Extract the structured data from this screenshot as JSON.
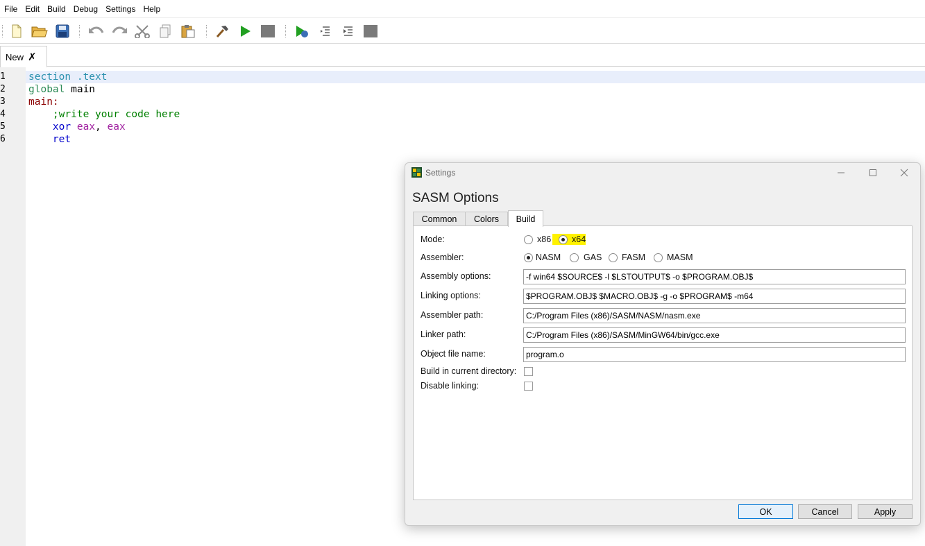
{
  "menubar": {
    "items": [
      "File",
      "Edit",
      "Build",
      "Debug",
      "Settings",
      "Help"
    ]
  },
  "toolbar": {
    "icons": [
      "new-file-icon",
      "open-folder-icon",
      "save-icon",
      "undo-icon",
      "redo-icon",
      "cut-icon",
      "copy-icon",
      "paste-icon",
      "build-hammer-icon",
      "run-icon",
      "stop-icon",
      "debug-icon",
      "step-over-icon",
      "step-into-icon",
      "debug-stop-icon"
    ]
  },
  "tabs": {
    "file_tab": "New",
    "close_glyph": "✗"
  },
  "editor": {
    "line_numbers": [
      "1",
      "2",
      "3",
      "4",
      "5",
      "6"
    ],
    "lines": [
      {
        "indent": "",
        "parts": [
          {
            "text": "section .text",
            "color": "#2b91af"
          }
        ]
      },
      {
        "indent": "",
        "parts": [
          {
            "text": "global",
            "color": "#2e8b57"
          },
          {
            "text": " main",
            "color": "#000000"
          }
        ]
      },
      {
        "indent": "",
        "parts": [
          {
            "text": "main:",
            "color": "#8b0000"
          }
        ]
      },
      {
        "indent": "    ",
        "parts": [
          {
            "text": ";write your code here",
            "color": "#008000"
          }
        ]
      },
      {
        "indent": "    ",
        "parts": [
          {
            "text": "xor",
            "color": "#0000cc"
          },
          {
            "text": " eax",
            "color": "#a020a0"
          },
          {
            "text": ", ",
            "color": "#000000"
          },
          {
            "text": "eax",
            "color": "#a020a0"
          }
        ]
      },
      {
        "indent": "    ",
        "parts": [
          {
            "text": "ret",
            "color": "#0000cc"
          }
        ]
      }
    ]
  },
  "settings_dialog": {
    "window_title": "Settings",
    "heading": "SASM Options",
    "tabs": [
      "Common",
      "Colors",
      "Build"
    ],
    "active_tab": "Build",
    "mode_label": "Mode:",
    "mode_options": [
      "x86",
      "x64"
    ],
    "mode_selected": "x64",
    "assembler_label": "Assembler:",
    "assembler_options": [
      "NASM",
      "GAS",
      "FASM",
      "MASM"
    ],
    "assembler_selected": "NASM",
    "assembly_options_label": "Assembly options:",
    "assembly_options_value": "-f win64 $SOURCE$ -l $LSTOUTPUT$ -o $PROGRAM.OBJ$",
    "linking_options_label": "Linking options:",
    "linking_options_value": "$PROGRAM.OBJ$ $MACRO.OBJ$ -g -o $PROGRAM$ -m64",
    "assembler_path_label": "Assembler path:",
    "assembler_path_value": "C:/Program Files (x86)/SASM/NASM/nasm.exe",
    "linker_path_label": "Linker path:",
    "linker_path_value": "C:/Program Files (x86)/SASM/MinGW64/bin/gcc.exe",
    "object_file_label": "Object file name:",
    "object_file_value": "program.o",
    "build_in_current_dir_label": "Build in current directory:",
    "build_in_current_dir_checked": false,
    "disable_linking_label": "Disable linking:",
    "disable_linking_checked": false,
    "ok_label": "OK",
    "cancel_label": "Cancel",
    "apply_label": "Apply",
    "highlight_color": "#fff200"
  }
}
